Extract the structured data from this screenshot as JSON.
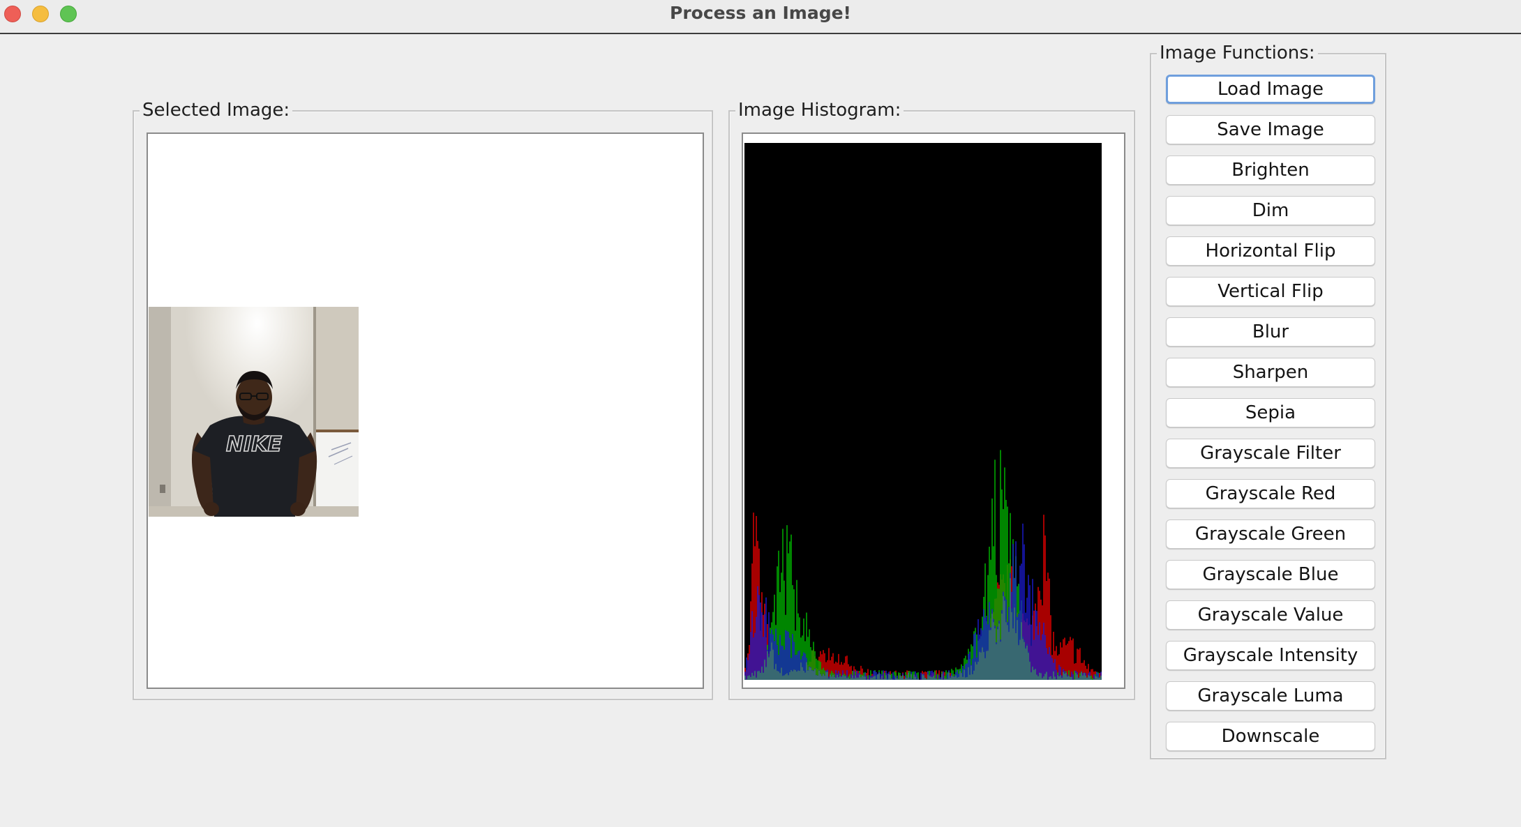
{
  "window": {
    "title": "Process an Image!"
  },
  "selected_image": {
    "label": "Selected Image:",
    "shirt_text": "NIKE"
  },
  "histogram": {
    "label": "Image Histogram:",
    "colors": {
      "background": "#000000",
      "red": "#cc0000",
      "green": "#00aa00",
      "blue": "#1a1acc"
    }
  },
  "functions": {
    "label": "Image Functions:",
    "buttons": [
      "Load Image",
      "Save Image",
      "Brighten",
      "Dim",
      "Horizontal Flip",
      "Vertical Flip",
      "Blur",
      "Sharpen",
      "Sepia",
      "Grayscale Filter",
      "Grayscale Red",
      "Grayscale Green",
      "Grayscale Blue",
      "Grayscale Value",
      "Grayscale Intensity",
      "Grayscale Luma",
      "Downscale"
    ],
    "focused_button": "Load Image"
  }
}
